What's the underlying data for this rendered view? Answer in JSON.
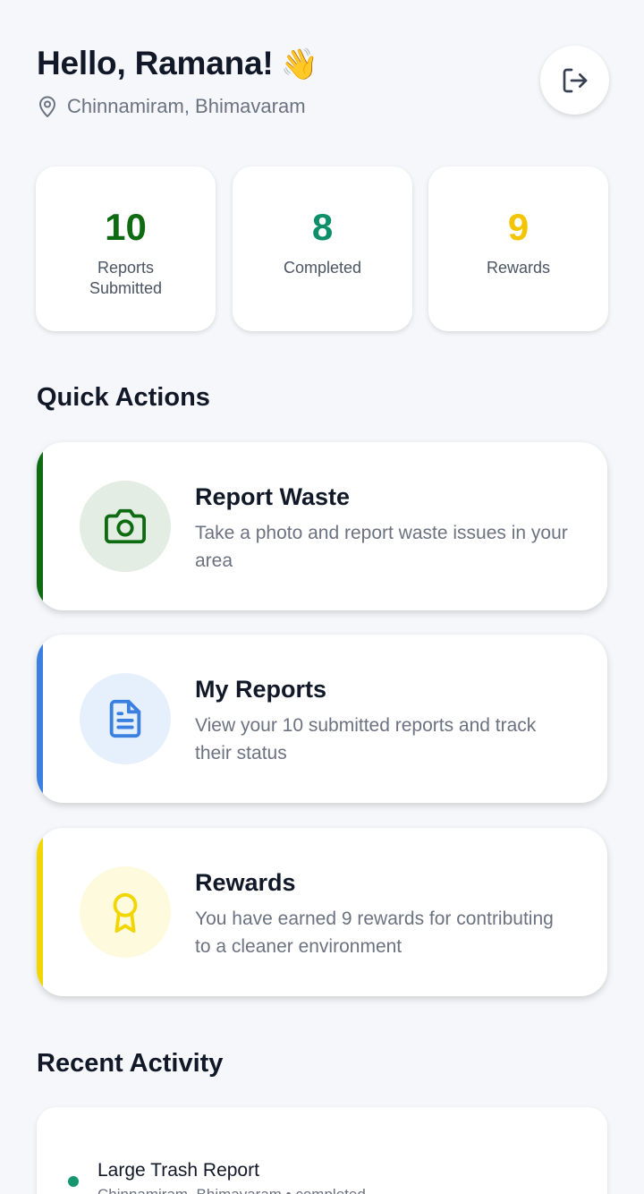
{
  "header": {
    "greeting": "Hello, Ramana!",
    "wave_emoji": "👋",
    "location": "Chinnamiram, Bhimavaram",
    "location_icon": "map-pin-icon",
    "logout_icon": "logout-icon"
  },
  "stats": [
    {
      "value": "10",
      "label": "Reports Submitted",
      "color": "#0f6b12"
    },
    {
      "value": "8",
      "label": "Completed",
      "color": "#0e8f6a"
    },
    {
      "value": "9",
      "label": "Rewards",
      "color": "#f2c500"
    }
  ],
  "sections": {
    "quick_actions": "Quick Actions",
    "recent_activity": "Recent Activity"
  },
  "actions": [
    {
      "title": "Report Waste",
      "description": "Take a photo and report waste issues in your area",
      "icon": "camera-icon",
      "accent": "#0f6b12",
      "icon_bg": "#e3ede3"
    },
    {
      "title": "My Reports",
      "description": "View your 10 submitted reports and track their status",
      "icon": "document-icon",
      "accent": "#3b7fe0",
      "icon_bg": "#e6f0fd"
    },
    {
      "title": "Rewards",
      "description": "You have earned 9 rewards for contributing to a cleaner environment",
      "icon": "award-icon",
      "accent": "#f2d600",
      "icon_bg": "#fefadd"
    }
  ],
  "recent": [
    {
      "title": "Large Trash Report",
      "subtitle": "Chinnamiram, Bhimavaram • completed",
      "dot_color": "#16966e"
    }
  ]
}
